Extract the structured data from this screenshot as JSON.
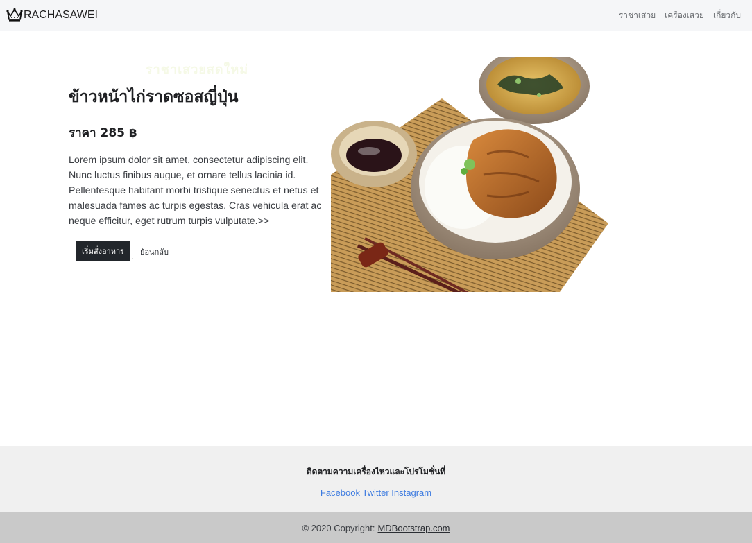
{
  "nav": {
    "brand": "RACHASAWEI",
    "brand_icon": "crown-icon",
    "links": [
      "ราชาเสวย",
      "เครื่องเสวย",
      "เกี่ยวกับ"
    ]
  },
  "main": {
    "faint_heading": "ราชาเสวยสดใหม่",
    "title": "ข้าวหน้าไก่ราดซอสญี่ปุ่น",
    "price": "ราคา 285 ฿",
    "description": "Lorem ipsum dolor sit amet, consectetur adipiscing elit. Nunc luctus finibus augue, et ornare tellus lacinia id. Pellentesque habitant morbi tristique senectus et netus et malesuada fames ac turpis egestas. Cras vehicula erat ac neque efficitur, eget rutrum turpis vulputate.>>",
    "order_button": "เริ่มสั่งอาหาร",
    "back_button": "ย้อนกลับ",
    "image_icon": "food-photo"
  },
  "footer": {
    "follow_text": "ติดตามความเครื่องไหวและโปรโมชั่นที่",
    "social_links": [
      "Facebook",
      "Twitter",
      "Instagram"
    ],
    "copyright_prefix": "© 2020 Copyright:",
    "copyright_link": "MDBootstrap.com"
  },
  "colors": {
    "navbar_bg": "#f5f6f8",
    "button_dark": "#22262b",
    "link_blue": "#3d7be0",
    "footer_top_bg": "#f0f0f0",
    "footer_bottom_bg": "#c9c9c9"
  }
}
